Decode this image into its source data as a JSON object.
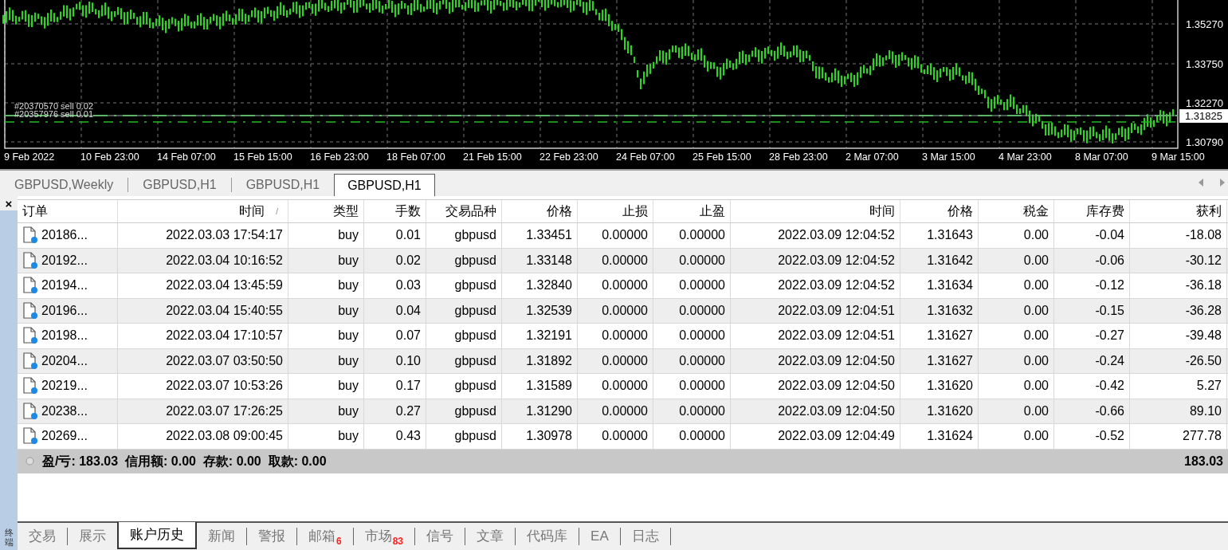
{
  "chart": {
    "price_labels": [
      "1.35270",
      "1.33750",
      "1.32270",
      "1.30790"
    ],
    "current_price": "1.31825",
    "order_labels": [
      "#20370570 sell 0.02",
      "#20357976 sell 0.01"
    ],
    "time_labels": [
      "9 Feb 2022",
      "10 Feb 23:00",
      "14 Feb 07:00",
      "15 Feb 15:00",
      "16 Feb 23:00",
      "18 Feb 07:00",
      "21 Feb 15:00",
      "22 Feb 23:00",
      "24 Feb 07:00",
      "25 Feb 15:00",
      "28 Feb 23:00",
      "2 Mar 07:00",
      "3 Mar 15:00",
      "4 Mar 23:00",
      "8 Mar 07:00",
      "9 Mar 15:00"
    ]
  },
  "chart_tabs": [
    {
      "label": "GBPUSD,Weekly",
      "selected": false
    },
    {
      "label": "GBPUSD,H1",
      "selected": false
    },
    {
      "label": "GBPUSD,H1",
      "selected": false
    },
    {
      "label": "GBPUSD,H1",
      "selected": true
    }
  ],
  "close_button": "×",
  "table": {
    "columns": [
      "订单",
      "时间",
      "类型",
      "手数",
      "交易品种",
      "价格",
      "止损",
      "止盈",
      "时间",
      "价格",
      "税金",
      "库存费",
      "获利"
    ],
    "sort_mark": "/",
    "rows": [
      [
        "20186...",
        "2022.03.03 17:54:17",
        "buy",
        "0.01",
        "gbpusd",
        "1.33451",
        "0.00000",
        "0.00000",
        "2022.03.09 12:04:52",
        "1.31643",
        "0.00",
        "-0.04",
        "-18.08"
      ],
      [
        "20192...",
        "2022.03.04 10:16:52",
        "buy",
        "0.02",
        "gbpusd",
        "1.33148",
        "0.00000",
        "0.00000",
        "2022.03.09 12:04:52",
        "1.31642",
        "0.00",
        "-0.06",
        "-30.12"
      ],
      [
        "20194...",
        "2022.03.04 13:45:59",
        "buy",
        "0.03",
        "gbpusd",
        "1.32840",
        "0.00000",
        "0.00000",
        "2022.03.09 12:04:52",
        "1.31634",
        "0.00",
        "-0.12",
        "-36.18"
      ],
      [
        "20196...",
        "2022.03.04 15:40:55",
        "buy",
        "0.04",
        "gbpusd",
        "1.32539",
        "0.00000",
        "0.00000",
        "2022.03.09 12:04:51",
        "1.31632",
        "0.00",
        "-0.15",
        "-36.28"
      ],
      [
        "20198...",
        "2022.03.04 17:10:57",
        "buy",
        "0.07",
        "gbpusd",
        "1.32191",
        "0.00000",
        "0.00000",
        "2022.03.09 12:04:51",
        "1.31627",
        "0.00",
        "-0.27",
        "-39.48"
      ],
      [
        "20204...",
        "2022.03.07 03:50:50",
        "buy",
        "0.10",
        "gbpusd",
        "1.31892",
        "0.00000",
        "0.00000",
        "2022.03.09 12:04:50",
        "1.31627",
        "0.00",
        "-0.24",
        "-26.50"
      ],
      [
        "20219...",
        "2022.03.07 10:53:26",
        "buy",
        "0.17",
        "gbpusd",
        "1.31589",
        "0.00000",
        "0.00000",
        "2022.03.09 12:04:50",
        "1.31620",
        "0.00",
        "-0.42",
        "5.27"
      ],
      [
        "20238...",
        "2022.03.07 17:26:25",
        "buy",
        "0.27",
        "gbpusd",
        "1.31290",
        "0.00000",
        "0.00000",
        "2022.03.09 12:04:50",
        "1.31620",
        "0.00",
        "-0.66",
        "89.10"
      ],
      [
        "20269...",
        "2022.03.08 09:00:45",
        "buy",
        "0.43",
        "gbpusd",
        "1.30978",
        "0.00000",
        "0.00000",
        "2022.03.09 12:04:49",
        "1.31624",
        "0.00",
        "-0.52",
        "277.78"
      ]
    ],
    "summary": "盈/亏: 183.03  信用额: 0.00  存款: 0.00  取款: 0.00",
    "summary_total": "183.03"
  },
  "side_label": "终端",
  "bottom_tabs": [
    {
      "label": "交易",
      "selected": false
    },
    {
      "label": "展示",
      "selected": false
    },
    {
      "label": "账户历史",
      "selected": true
    },
    {
      "label": "新闻",
      "selected": false
    },
    {
      "label": "警报",
      "selected": false
    },
    {
      "label": "邮箱",
      "badge": "6",
      "selected": false
    },
    {
      "label": "市场",
      "badge": "83",
      "selected": false
    },
    {
      "label": "信号",
      "selected": false
    },
    {
      "label": "文章",
      "selected": false
    },
    {
      "label": "代码库",
      "selected": false
    },
    {
      "label": "EA",
      "selected": false
    },
    {
      "label": "日志",
      "selected": false
    }
  ]
}
